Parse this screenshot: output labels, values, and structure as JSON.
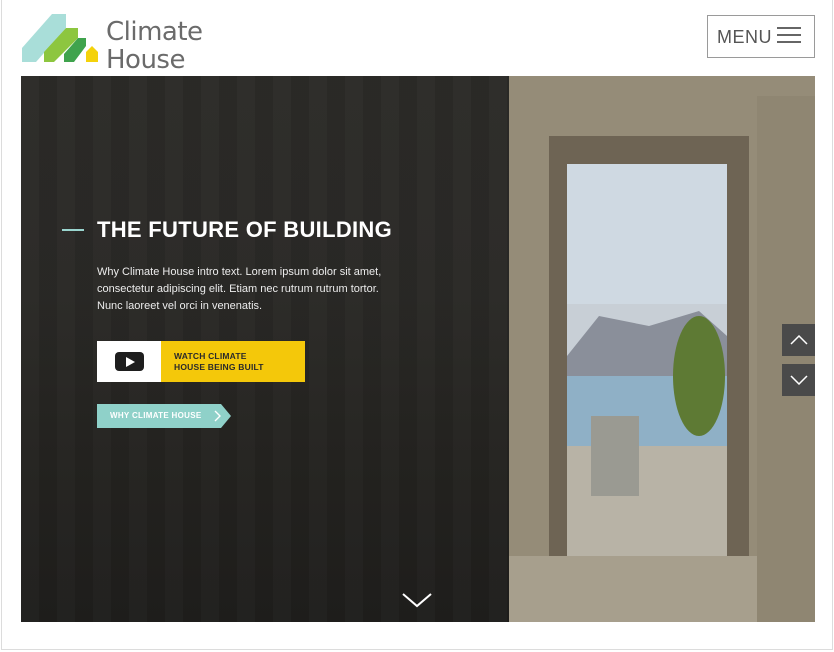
{
  "brand": {
    "line1": "Climate",
    "line2": "House",
    "colors": {
      "teal": "#a9ded9",
      "lime": "#8dc63f",
      "green": "#3fa34d",
      "yellow": "#f4d20b",
      "text": "#6b6b6b"
    }
  },
  "header": {
    "menu_label": "MENU",
    "menu_icon": "hamburger-icon"
  },
  "hero": {
    "title": "THE FUTURE OF BUILDING",
    "intro": "Why Climate House intro text. Lorem ipsum dolor sit amet, consectetur adipiscing elit. Etiam nec rutrum rutrum tortor. Nunc laoreet vel orci in venenatis.",
    "watch_button": {
      "line1": "WATCH CLIMATE",
      "line2": "HOUSE BEING BUILT",
      "icon": "youtube-play-icon",
      "color": "#f4c80a"
    },
    "why_button": {
      "label": "WHY CLIMATE HOUSE",
      "color": "#8fd1c9"
    },
    "nav": {
      "up_icon": "chevron-up-icon",
      "down_icon": "chevron-down-icon"
    },
    "scroll_icon": "chevron-down-icon"
  }
}
